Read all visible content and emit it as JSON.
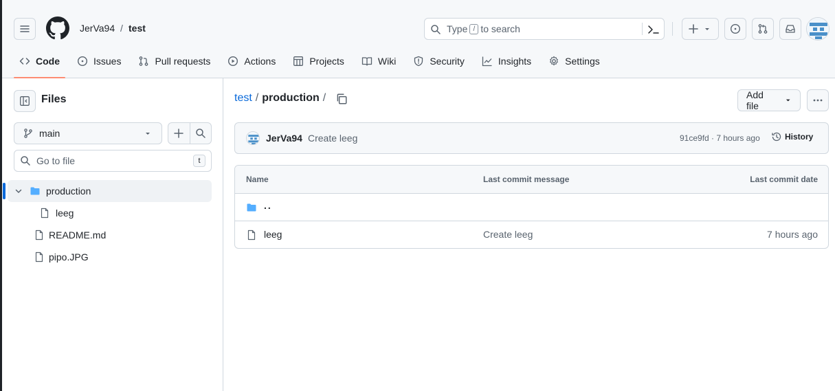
{
  "header": {
    "owner": "JerVa94",
    "separator": "/",
    "repo": "test",
    "search_placeholder": "Type",
    "search_slash": "/",
    "search_suffix": "to search"
  },
  "nav": [
    {
      "label": "Code",
      "icon": "code-icon",
      "active": true
    },
    {
      "label": "Issues",
      "icon": "issue-icon"
    },
    {
      "label": "Pull requests",
      "icon": "pull-request-icon"
    },
    {
      "label": "Actions",
      "icon": "play-icon"
    },
    {
      "label": "Projects",
      "icon": "table-icon"
    },
    {
      "label": "Wiki",
      "icon": "book-icon"
    },
    {
      "label": "Security",
      "icon": "shield-icon"
    },
    {
      "label": "Insights",
      "icon": "graph-icon"
    },
    {
      "label": "Settings",
      "icon": "gear-icon"
    }
  ],
  "sidebar": {
    "title": "Files",
    "branch": "main",
    "goto_placeholder": "Go to file",
    "goto_key": "t",
    "tree": [
      {
        "label": "production",
        "type": "folder"
      },
      {
        "label": "leeg",
        "type": "file"
      },
      {
        "label": "README.md",
        "type": "file"
      },
      {
        "label": "pipo.JPG",
        "type": "file"
      }
    ]
  },
  "main": {
    "crumb_root": "test",
    "crumb_sep": "/",
    "crumb_current": "production",
    "crumb_trail": "/",
    "add_file": "Add file",
    "commit": {
      "author": "JerVa94",
      "message": "Create leeg",
      "meta": "91ce9fd · 7 hours ago",
      "history": "History"
    },
    "table": {
      "col_name": "Name",
      "col_message": "Last commit message",
      "col_date": "Last commit date",
      "parent": "..",
      "rows": [
        {
          "name": "leeg",
          "message": "Create leeg",
          "date": "7 hours ago"
        }
      ]
    }
  },
  "colors": {
    "accent": "#0969da",
    "folder": "#54aeff",
    "underline": "#fd8c73",
    "border": "#d0d7de"
  }
}
